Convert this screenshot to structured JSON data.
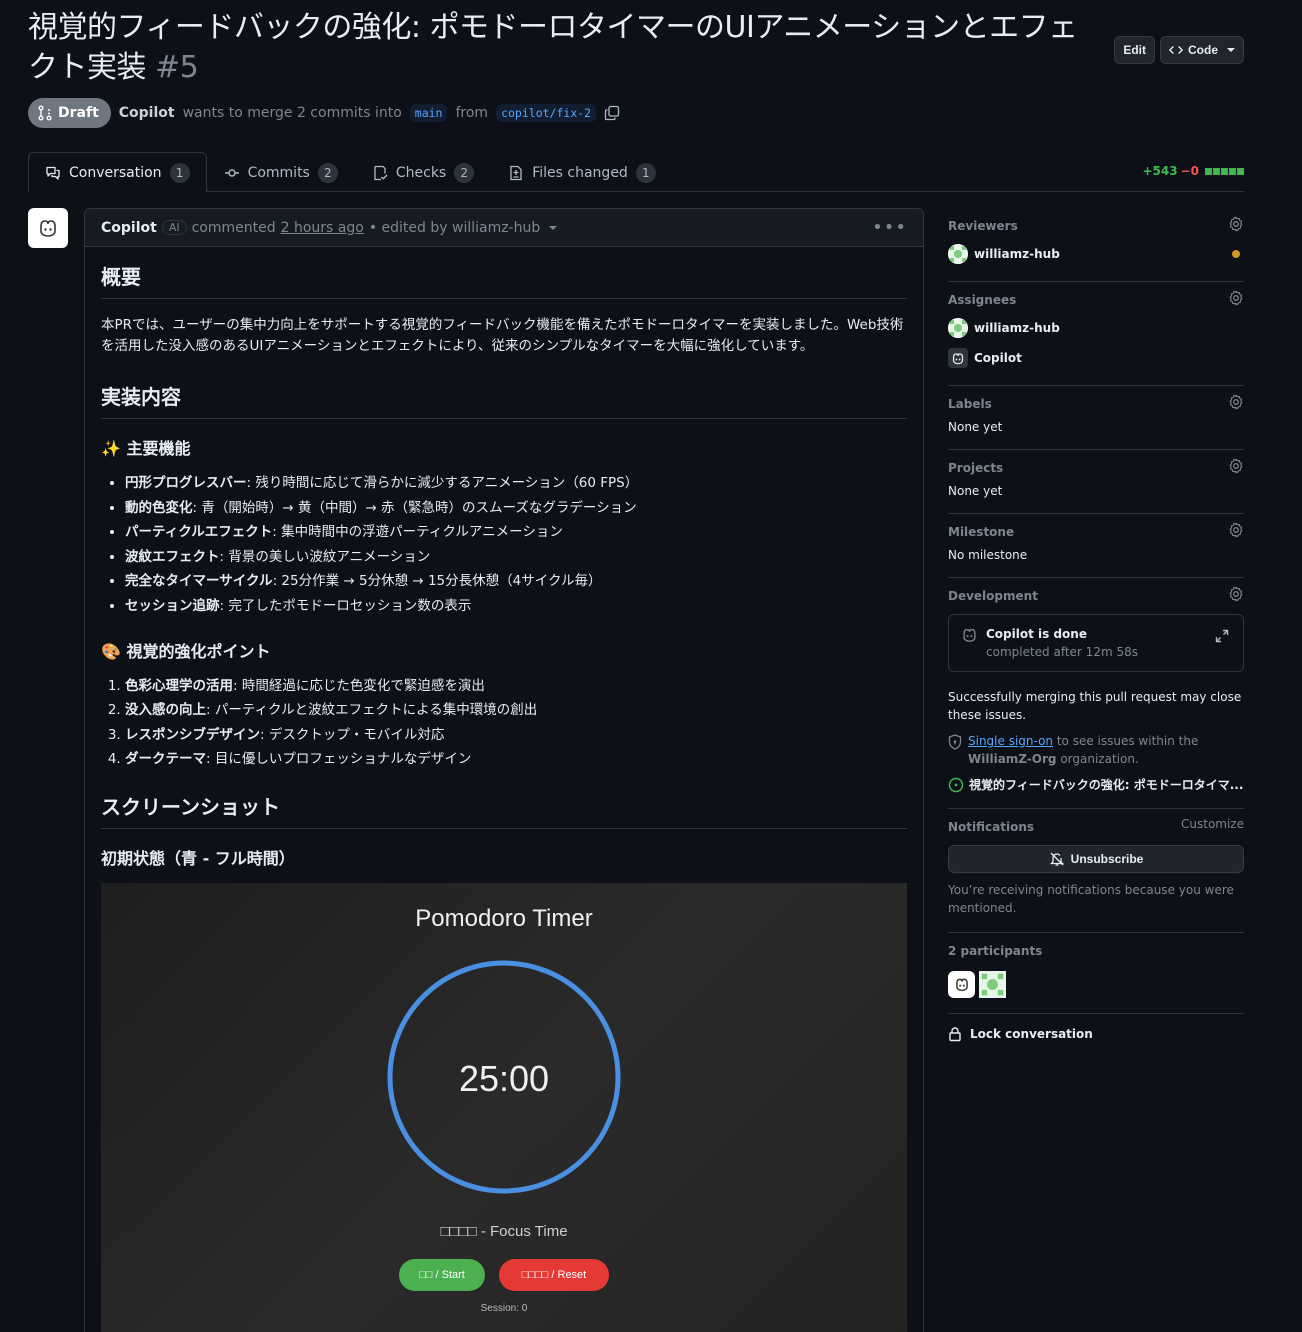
{
  "pr": {
    "title": "視覚的フィードバックの強化: ポモドーロタイマーのUIアニメーションとエフェクト実装",
    "number": "#5",
    "edit_label": "Edit",
    "code_label": "Code",
    "draft_label": "Draft",
    "author": "Copilot",
    "merge_text": "wants to merge 2 commits into",
    "base_branch": "main",
    "from_text": "from",
    "head_branch": "copilot/fix-2"
  },
  "tabs": [
    {
      "label": "Conversation",
      "count": "1"
    },
    {
      "label": "Commits",
      "count": "2"
    },
    {
      "label": "Checks",
      "count": "2"
    },
    {
      "label": "Files changed",
      "count": "1"
    }
  ],
  "diffstat": {
    "additions": "+543",
    "deletions": "−0"
  },
  "comment": {
    "author": "Copilot",
    "badge": "AI",
    "action": "commented",
    "time": "2 hours ago",
    "edited": "• edited by williamz-hub",
    "h_overview": "概要",
    "overview_text": "本PRでは、ユーザーの集中力向上をサポートする視覚的フィードバック機能を備えたポモドーロタイマーを実装しました。Web技術を活用した没入感のあるUIアニメーションとエフェクトにより、従来のシンプルなタイマーを大幅に強化しています。",
    "h_impl": "実装内容",
    "h_features": "✨ 主要機能",
    "features": [
      {
        "b": "円形プログレスバー",
        "t": ": 残り時間に応じて滑らかに減少するアニメーション（60 FPS）"
      },
      {
        "b": "動的色変化",
        "t": ": 青（開始時）→ 黄（中間）→ 赤（緊急時）のスムーズなグラデーション"
      },
      {
        "b": "パーティクルエフェクト",
        "t": ": 集中時間中の浮遊パーティクルアニメーション"
      },
      {
        "b": "波紋エフェクト",
        "t": ": 背景の美しい波紋アニメーション"
      },
      {
        "b": "完全なタイマーサイクル",
        "t": ": 25分作業 → 5分休憩 → 15分長休憩（4サイクル毎）"
      },
      {
        "b": "セッション追跡",
        "t": ": 完了したポモドーロセッション数の表示"
      }
    ],
    "h_visual": "🎨 視覚的強化ポイント",
    "visual_points": [
      {
        "b": "色彩心理学の活用",
        "t": ": 時間経過に応じた色変化で緊迫感を演出"
      },
      {
        "b": "没入感の向上",
        "t": ": パーティクルと波紋エフェクトによる集中環境の創出"
      },
      {
        "b": "レスポンシブデザイン",
        "t": ": デスクトップ・モバイル対応"
      },
      {
        "b": "ダークテーマ",
        "t": ": 目に優しいプロフェッショナルなデザイン"
      }
    ],
    "h_screenshots": "スクリーンショット",
    "h_initial": "初期状態（青 - フル時間）"
  },
  "timer": {
    "title": "Pomodoro Timer",
    "time": "25:00",
    "mode": "□□□□ - Focus Time",
    "start_label": "□□ / Start",
    "reset_label": "□□□□ / Reset",
    "session": "Session: 0",
    "progress": 1.0,
    "ring_color": "#4a90e2"
  },
  "sidebar": {
    "reviewers": {
      "heading": "Reviewers",
      "name": "williamz-hub"
    },
    "assignees": {
      "heading": "Assignees",
      "names": [
        "williamz-hub",
        "Copilot"
      ]
    },
    "labels": {
      "heading": "Labels",
      "value": "None yet"
    },
    "projects": {
      "heading": "Projects",
      "value": "None yet"
    },
    "milestone": {
      "heading": "Milestone",
      "value": "No milestone"
    },
    "development": {
      "heading": "Development",
      "card_title": "Copilot is done",
      "card_sub": "completed after 12m 58s",
      "note": "Successfully merging this pull request may close these issues.",
      "sso_link": "Single sign-on",
      "sso_text": "to see issues within the",
      "org": "WilliamZ-Org",
      "org_suffix": "organization.",
      "issue": "視覚的フィードバックの強化: ポモドーロタイマ..."
    },
    "notifications": {
      "heading": "Notifications",
      "customize": "Customize",
      "unsubscribe": "Unsubscribe",
      "reason": "You’re receiving notifications because you were mentioned."
    },
    "participants": {
      "heading": "2 participants"
    },
    "lock": "Lock conversation"
  },
  "colors": {
    "accent": "#58a6ff",
    "success": "#3fb950",
    "danger": "#f85149",
    "pending": "#d29922"
  }
}
